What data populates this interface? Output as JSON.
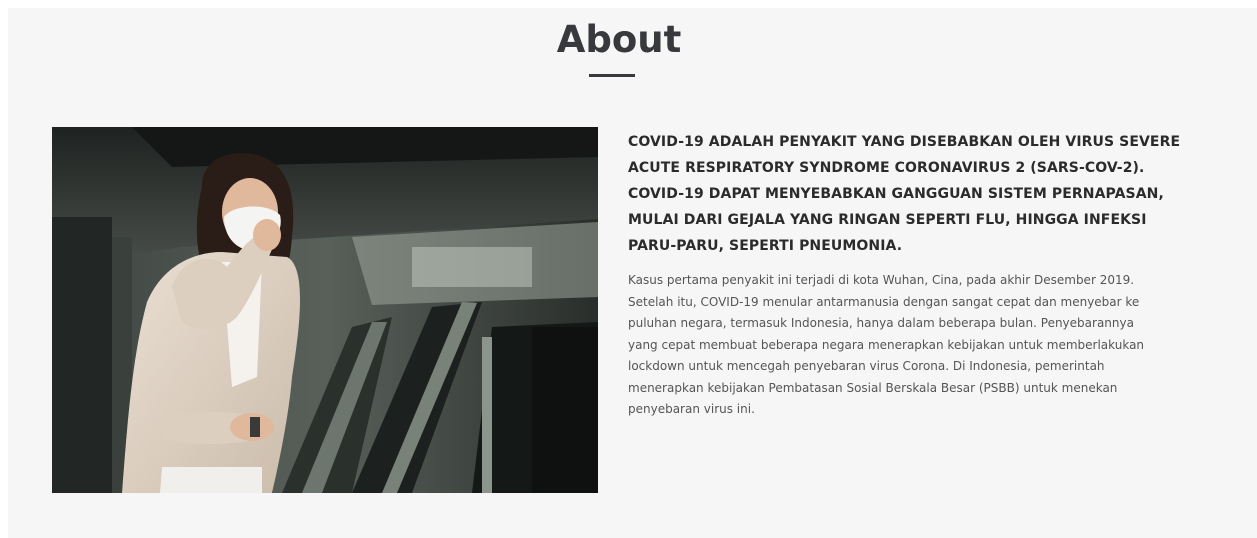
{
  "about": {
    "title": "About",
    "heading": "COVID-19 ADALAH PENYAKIT YANG DISEBABKAN OLEH VIRUS SEVERE ACUTE RESPIRATORY SYNDROME CORONAVIRUS 2 (SARS-COV-2). COVID-19 DAPAT MENYEBABKAN GANGGUAN SISTEM PERNAPASAN, MULAI DARI GEJALA YANG RINGAN SEPERTI FLU, HINGGA INFEKSI PARU-PARU, SEPERTI PNEUMONIA.",
    "body": "Kasus pertama penyakit ini terjadi di kota Wuhan, Cina, pada akhir Desember 2019. Setelah itu, COVID-19 menular antarmanusia dengan sangat cepat dan menyebar ke puluhan negara, termasuk Indonesia, hanya dalam beberapa bulan. Penyebarannya yang cepat membuat beberapa negara menerapkan kebijakan untuk memberlakukan lockdown untuk mencegah penyebaran virus Corona. Di Indonesia, pemerintah menerapkan kebijakan Pembatasan Sosial Berskala Besar (PSBB) untuk menekan penyebaran virus ini.",
    "image_icon": "woman-coughing-with-mask-photo"
  },
  "colors": {
    "section_bg": "#f6f6f6",
    "title": "#37393d",
    "heading": "#2b2b2b",
    "body": "#555555"
  }
}
